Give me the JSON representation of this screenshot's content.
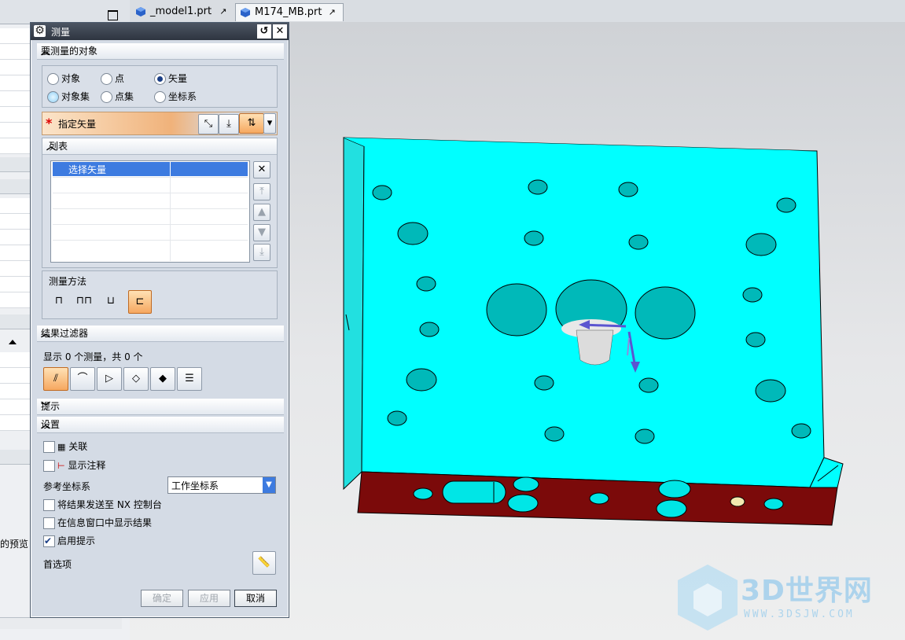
{
  "tabs": [
    {
      "label": "_model1.prt",
      "active": false
    },
    {
      "label": "M174_MB.prt",
      "active": true
    }
  ],
  "nav": {
    "preview_text": "的预览"
  },
  "dialog": {
    "title": "测量",
    "sections": {
      "objects": "要测量的对象",
      "list": "列表",
      "method": "测量方法",
      "filter": "结果过滤器",
      "hint": "提示",
      "settings": "设置"
    },
    "radios": [
      {
        "label": "对象",
        "selected": false
      },
      {
        "label": "点",
        "selected": false
      },
      {
        "label": "矢量",
        "selected": true
      },
      {
        "label": "对象集",
        "selected": false
      },
      {
        "label": "点集",
        "selected": false
      },
      {
        "label": "坐标系",
        "selected": false
      }
    ],
    "specify_vector": "指定矢量",
    "list_rows": [
      "选择矢量",
      "",
      "",
      "",
      "",
      ""
    ],
    "filter_text": "显示 0 个测量，共 0 个",
    "settings": {
      "associative": "关联",
      "show_annotation": "显示注释",
      "ref_csys_label": "参考坐标系",
      "ref_csys_value": "工作坐标系",
      "send_nx": "将结果发送至 NX 控制台",
      "show_info": "在信息窗口中显示结果",
      "enable_hint": "启用提示",
      "enable_hint_checked": true,
      "preferences": "首选项"
    },
    "buttons": {
      "ok": "确定",
      "apply": "应用",
      "cancel": "取消"
    }
  },
  "watermark": {
    "brand": "3D世界网",
    "url": "WWW.3DSJW.COM"
  },
  "colors": {
    "part_top": "#00ffff",
    "part_side_front": "#7b0a0a",
    "part_side_left": "#2ee6e6",
    "accent_orange": "#f6a860"
  }
}
